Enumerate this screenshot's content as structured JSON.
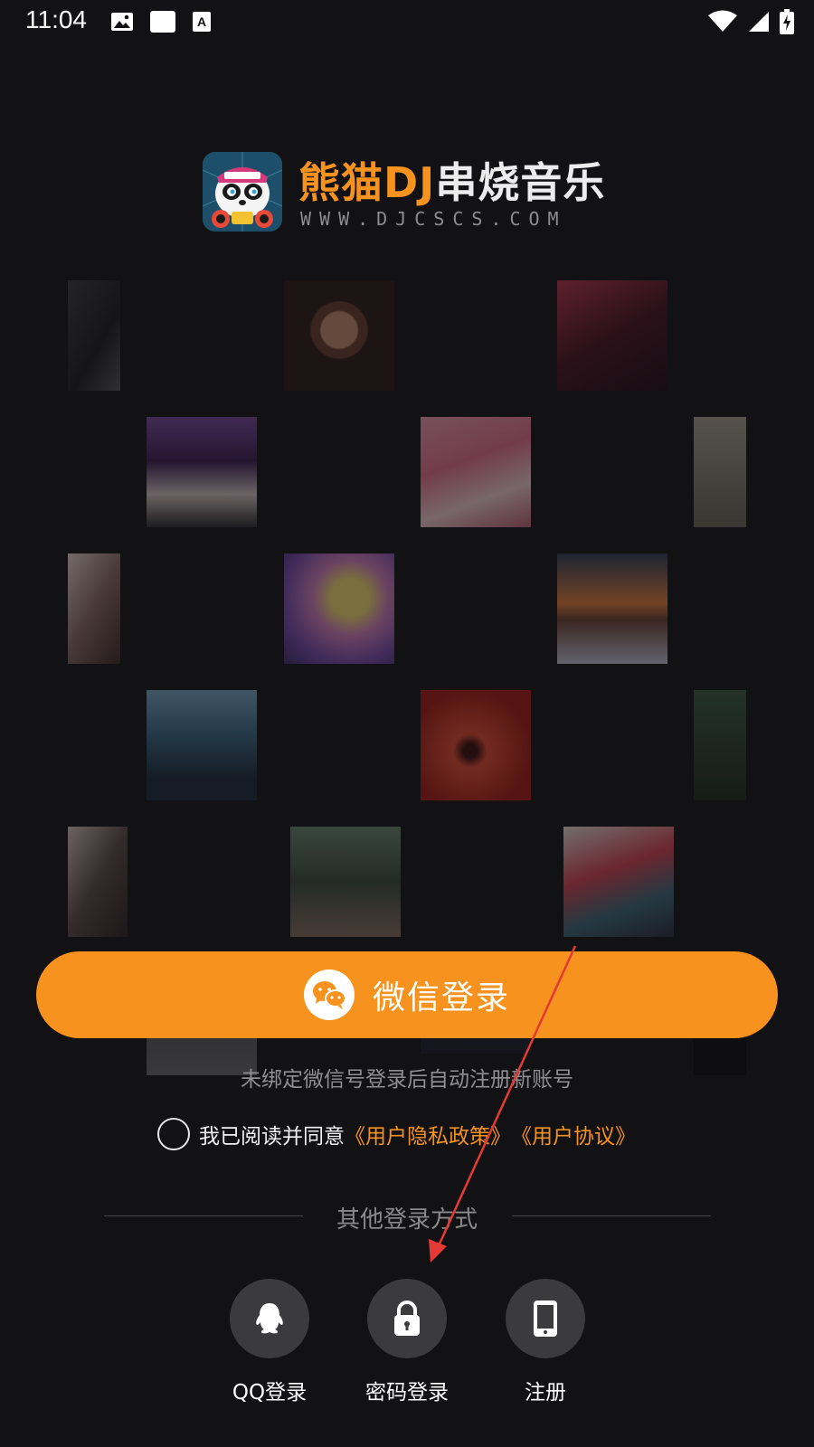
{
  "status_bar": {
    "time": "11:04"
  },
  "brand": {
    "title_orange": "熊猫DJ",
    "title_white": "串烧音乐",
    "url": "WWW.DJCSCS.COM"
  },
  "wechat_login": {
    "label": "微信登录"
  },
  "hint_text": "未绑定微信号登录后自动注册新账号",
  "agreement": {
    "prefix": "我已阅读并同意",
    "privacy_link": "《用户隐私政策》",
    "terms_link": "《用户协议》"
  },
  "other_login": {
    "divider_label": "其他登录方式",
    "options": [
      {
        "label": "QQ登录",
        "icon": "qq-penguin-icon"
      },
      {
        "label": "密码登录",
        "icon": "lock-icon"
      },
      {
        "label": "注册",
        "icon": "phone-icon"
      }
    ]
  },
  "colors": {
    "accent": "#f6921d",
    "background": "#121114",
    "option_circle": "#3b3b3d"
  },
  "annotation": {
    "type": "red arrow pointing to password login"
  }
}
